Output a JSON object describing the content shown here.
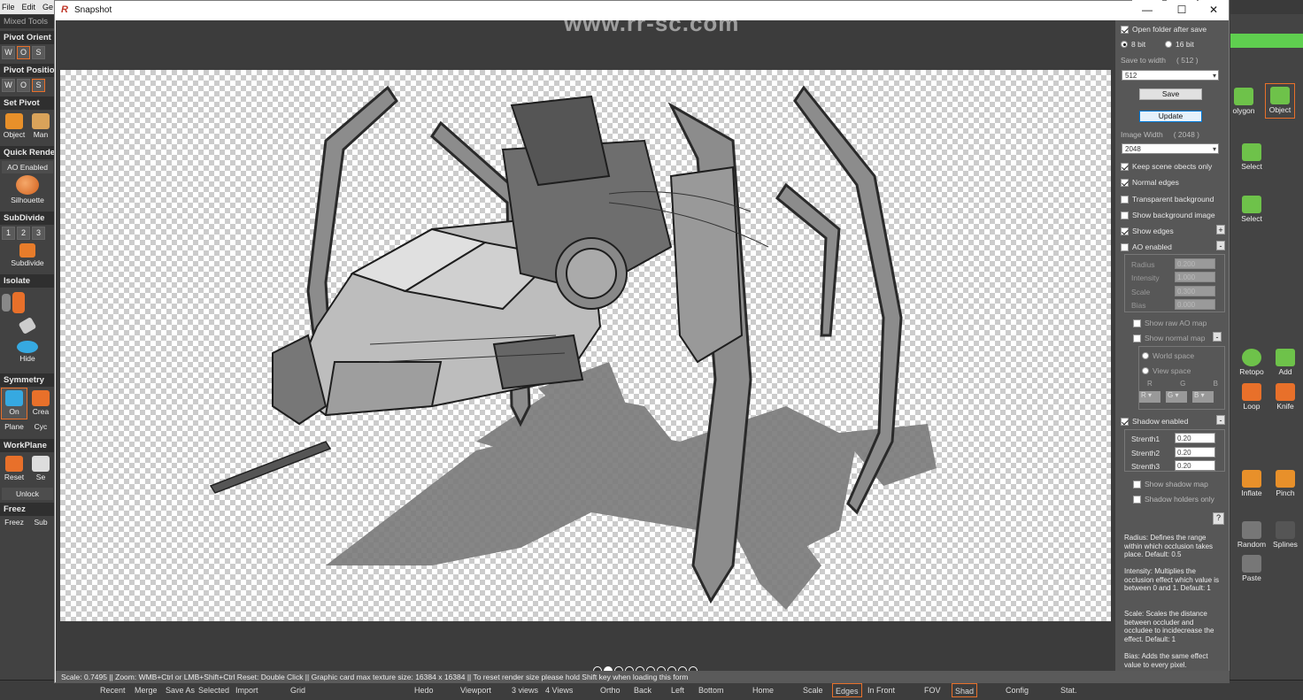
{
  "menubar": {
    "items": [
      "File",
      "Edit",
      "Ge"
    ]
  },
  "left_panel": {
    "mixed_tools": "Mixed Tools",
    "pivot_orient": "Pivot Orient",
    "pivot_orient_btns": [
      "W",
      "O",
      "S"
    ],
    "pivot_position": "Pivot Positio",
    "pivot_position_btns": [
      "W",
      "O",
      "S"
    ],
    "set_pivot": "Set Pivot",
    "object": "Object",
    "manual": "Man",
    "quick_render": "Quick Rende",
    "ao_enabled": "AO Enabled",
    "silhouette": "Silhouette",
    "subdivide_header": "SubDivide",
    "subdivide_levels": [
      "1",
      "2",
      "3"
    ],
    "subdivide": "Subdivide",
    "isolate": "Isolate",
    "hide": "Hide",
    "symmetry": "Symmetry",
    "on": "On",
    "create": "Crea",
    "plane": "Plane",
    "cycle": "Cyc",
    "workplane": "WorkPlane",
    "reset": "Reset",
    "set": "Se",
    "unlock": "Unlock",
    "freez_header": "Freez",
    "freez": "Freez",
    "sub": "Sub"
  },
  "right_panel": {
    "polygon": "olygon",
    "object": "Object",
    "select1": "Select",
    "select2": "Select",
    "retopo": "Retopo",
    "add": "Add",
    "loop": "Loop",
    "knife": "Knife",
    "inflate": "Inflate",
    "pinch": "Pinch",
    "random": "Random",
    "splines": "Splines",
    "paste": "Paste"
  },
  "bottom_bar": [
    "Recent",
    "Merge",
    "Save As",
    "Selected",
    "Import",
    "Grid",
    "Hedo",
    "Viewport",
    "3 views",
    "4 Views",
    "Ortho",
    "Back",
    "Left",
    "Bottom",
    "Home",
    "Scale",
    "Edges",
    "In Front",
    "FOV",
    "Shad",
    "Config",
    "Stat."
  ],
  "window": {
    "title": "Snapshot",
    "minimize": "—",
    "maximize": "☐",
    "close": "✕"
  },
  "watermark": "www.rr-sc.com",
  "status": "Scale: 0.7495   ||   Zoom: WMB+Ctrl or LMB+Shift+Ctrl   Reset: Double Click   ||   Graphic card max texture size: 16384 x 16384   ||   To reset render size please hold Shift key when loading this form",
  "options": {
    "open_folder": "Open folder after save",
    "bit8": "8 bit",
    "bit16": "16 bit",
    "save_to_width": "Save to width",
    "save_to_width_val": "( 512 )",
    "save_width_select": "512",
    "save": "Save",
    "update": "Update",
    "image_width": "Image Width",
    "image_width_val": "( 2048 )",
    "image_width_select": "2048",
    "keep_scene": "Keep scene obects only",
    "normal_edges": "Normal edges",
    "transparent_bg": "Transparent background",
    "show_bg_image": "Show background image",
    "show_edges": "Show edges",
    "ao_enabled": "AO enabled",
    "radius": "Radius",
    "radius_val": "0.200",
    "intensity": "Intensity",
    "intensity_val": "1.000",
    "scale": "Scale",
    "scale_val": "0.300",
    "bias": "Bias",
    "bias_val": "0.000",
    "show_raw_ao": "Show raw AO map",
    "show_normal_map": "Show normal map",
    "world_space": "World space",
    "view_space": "View space",
    "r": "R",
    "g": "G",
    "b": "B",
    "shadow_enabled": "Shadow enabled",
    "strenth1": "Strenth1",
    "strenth1_val": "0.20",
    "strenth2": "Strenth2",
    "strenth2_val": "0.20",
    "strenth3": "Strenth3",
    "strenth3_val": "0.20",
    "show_shadow_map": "Show shadow map",
    "shadow_holders": "Shadow holders only",
    "help_btn": "?",
    "help_radius": "Radius: Defines the range within which occlusion takes place. Default: 0.5",
    "help_intensity": "Intensity: Multiplies the occlusion effect which value is between 0 and 1. Default: 1",
    "help_scale": "Scale: Scales the distance between occluder and occludee to incidecrease the effect. Default: 1",
    "help_bias": "Bias: Adds the same effect value to every pixel."
  }
}
